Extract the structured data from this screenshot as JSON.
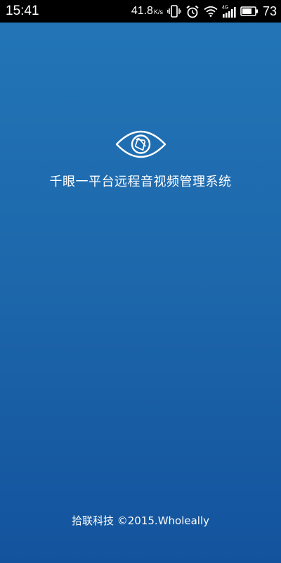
{
  "status_bar": {
    "time": "15:41",
    "network_speed": "41.8",
    "network_speed_unit": "K/s",
    "network_type": "4G",
    "battery_level": "73",
    "icons": [
      "vibrate-icon",
      "alarm-icon",
      "wifi-icon",
      "cellular-signal-icon",
      "battery-icon"
    ]
  },
  "splash": {
    "logo_icon": "eye-aperture-icon",
    "app_title": "千眼一平台远程音视频管理系统",
    "copyright": "拾联科技 ©2015.Wholeally"
  },
  "colors": {
    "gradient_top": "#2276b8",
    "gradient_bottom": "#13539d",
    "text": "#ffffff",
    "status_bar_background": "#000000"
  }
}
